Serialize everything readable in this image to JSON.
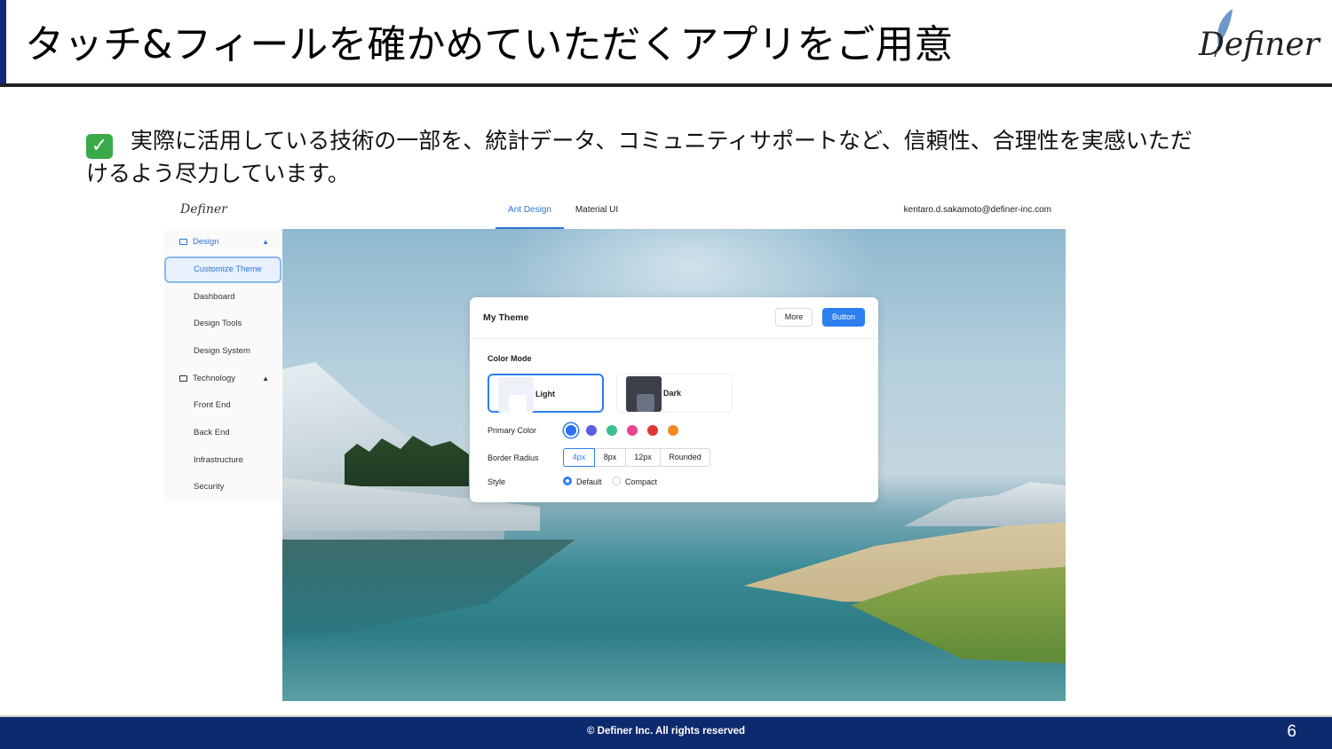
{
  "slide": {
    "title": "タッチ&フィールを確かめていただくアプリをご用意",
    "logo_text": "Definer",
    "body_text": "実際に活用している技術の一部を、統計データ、コミュニティサポートなど、信頼性、合理性を実感いただけるよう尽力しています。",
    "check_icon": "✓"
  },
  "app": {
    "logo_text": "Definer",
    "tabs": [
      {
        "label": "Ant Design",
        "active": true
      },
      {
        "label": "Material UI",
        "active": false
      }
    ],
    "user_email": "kentaro.d.sakamoto@definer-inc.com",
    "sidebar": {
      "groups": [
        {
          "label": "Design",
          "active": true,
          "items": [
            "Customize Theme",
            "Dashboard",
            "Design Tools",
            "Design System"
          ],
          "selected": "Customize Theme"
        },
        {
          "label": "Technology",
          "active": false,
          "items": [
            "Front End",
            "Back End",
            "Infrastructure",
            "Security"
          ]
        }
      ]
    },
    "theme_card": {
      "title": "My Theme",
      "more_label": "More",
      "button_label": "Button",
      "color_mode_label": "Color Mode",
      "modes": [
        {
          "label": "Light",
          "selected": true
        },
        {
          "label": "Dark",
          "selected": false
        }
      ],
      "primary_color_label": "Primary Color",
      "primary_colors": [
        "#2d6ff0",
        "#5a5ce6",
        "#3bbf8f",
        "#e8468e",
        "#e03636",
        "#f08a24"
      ],
      "selected_color_index": 0,
      "border_radius_label": "Border Radius",
      "radius_options": [
        "4px",
        "8px",
        "12px",
        "Rounded"
      ],
      "selected_radius": "4px",
      "style_label": "Style",
      "style_options": [
        {
          "label": "Default",
          "checked": true
        },
        {
          "label": "Compact",
          "checked": false
        }
      ]
    }
  },
  "footer": {
    "copyright": "© Definer Inc. All rights reserved",
    "page_number": "6"
  },
  "colors": {
    "brand_navy": "#0e2a6e",
    "accent_blue": "#2d7ff0",
    "check_green": "#39a94a"
  }
}
